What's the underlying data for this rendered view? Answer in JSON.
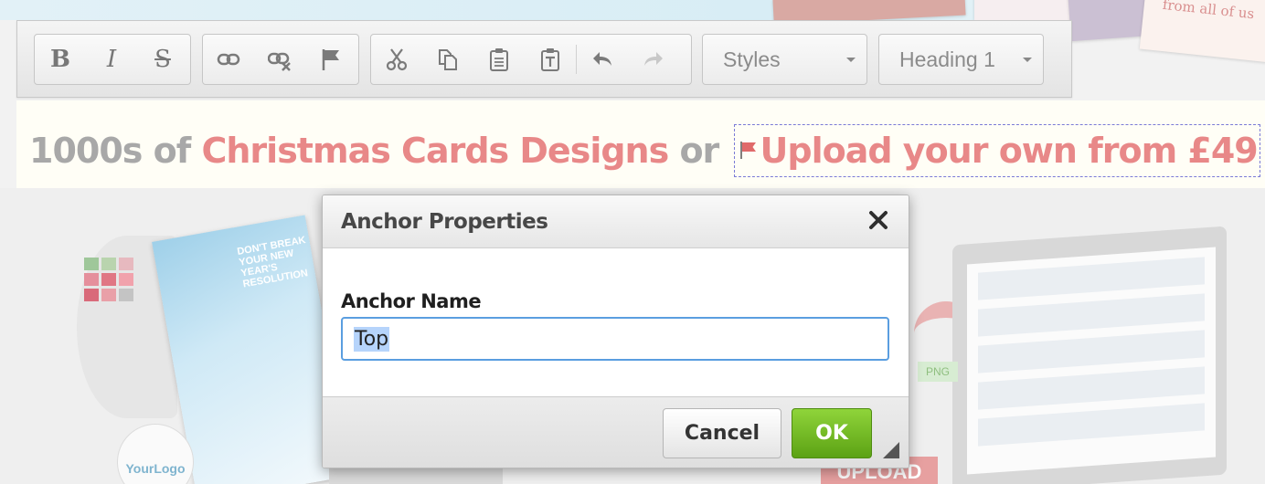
{
  "background": {
    "flyer_text": "DON'T BREAK YOUR NEW YEAR'S RESOLUTION",
    "logo_text": "YourLogo",
    "card_text": "from all of us",
    "file_badge": "PNG",
    "upload_text": "UPLOAD"
  },
  "toolbar": {
    "bold_label": "B",
    "italic_label": "I",
    "strike_label": "S",
    "styles_label": "Styles",
    "format_label": "Heading 1"
  },
  "content": {
    "heading_part1": "1000s of ",
    "heading_part2": "Christmas Cards Designs",
    "heading_part3": " or ",
    "anchor_link_text": "Upload your own from £49"
  },
  "dialog": {
    "title": "Anchor Properties",
    "field_label": "Anchor Name",
    "field_value": "Top",
    "cancel_label": "Cancel",
    "ok_label": "OK"
  },
  "colors": {
    "accent_pink": "#e88888",
    "heading_gray": "#a8a8a8",
    "ok_green": "#6db224",
    "focus_blue": "#5a9ee0"
  },
  "icons": [
    "bold-icon",
    "italic-icon",
    "strikethrough-icon",
    "link-icon",
    "unlink-icon",
    "anchor-flag-icon",
    "cut-icon",
    "copy-icon",
    "paste-icon",
    "paste-text-icon",
    "undo-icon",
    "redo-icon",
    "close-icon"
  ]
}
